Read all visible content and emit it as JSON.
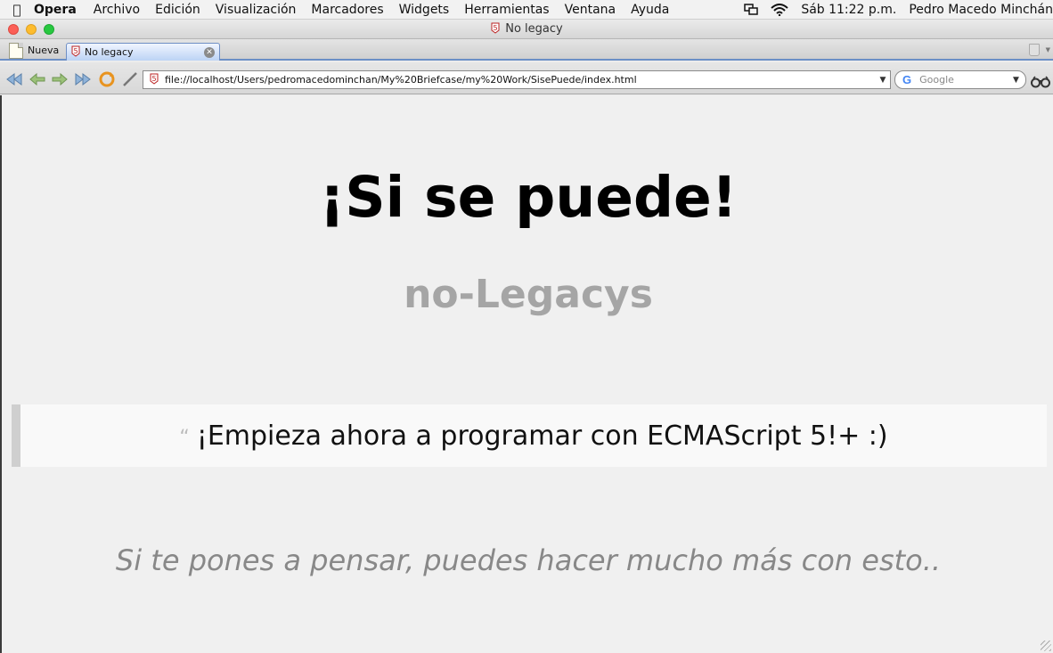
{
  "menubar": {
    "app_name": "Opera",
    "items": [
      "Archivo",
      "Edición",
      "Visualización",
      "Marcadores",
      "Widgets",
      "Herramientas",
      "Ventana",
      "Ayuda"
    ],
    "clock": "Sáb 11:22 p.m.",
    "user": "Pedro Macedo Minchán"
  },
  "window": {
    "title": "No legacy"
  },
  "tabs": {
    "new_tab_label": "Nueva",
    "active_tab_label": "No legacy"
  },
  "toolbar": {
    "url": "file://localhost/Users/pedromacedominchan/My%20Briefcase/my%20Work/SisePuede/index.html",
    "search_engine": "Google"
  },
  "page": {
    "title": "¡Si se puede!",
    "subtitle": "no-Legacys",
    "quote_mark": "“",
    "quote": "¡Empieza ahora a programar con ECMAScript 5!+ :)",
    "tagline": "Si te pones a pensar, puedes hacer mucho más con esto.."
  },
  "colors": {
    "subtitle": "#a5a5a5",
    "tagline": "#888888",
    "tab_active": "#bcd3f5"
  }
}
